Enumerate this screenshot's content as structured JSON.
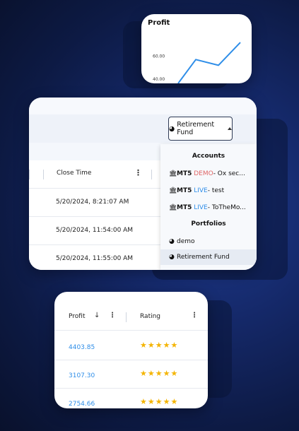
{
  "profit_chart": {
    "title": "Profit",
    "y_tick_labels": [
      "60.00",
      "40.00"
    ],
    "line_color": "#2f8ee8",
    "chart_data": {
      "type": "line",
      "title": "Profit",
      "yticks": [
        60,
        40
      ],
      "ylim": [
        38,
        82
      ],
      "series": [
        {
          "values": [
            36,
            57,
            52,
            72
          ]
        }
      ]
    }
  },
  "portfolio_selector": {
    "selected_label": "Retirement Fund",
    "icon": "pie-chart-icon"
  },
  "trades_table": {
    "close_time_header": "Close Time",
    "rows": [
      {
        "close_time": "5/20/2024, 8:21:07 AM"
      },
      {
        "close_time": "5/20/2024, 11:54:00 AM"
      },
      {
        "close_time": "5/20/2024, 11:55:00 AM"
      }
    ]
  },
  "dropdown_menu": {
    "accounts_heading": "Accounts",
    "accounts": [
      {
        "platform": "MT5",
        "type": "DEMO",
        "name": " - Ox sec...",
        "icon": "bank-icon"
      },
      {
        "platform": "MT5",
        "type": "LIVE",
        "name": " - test",
        "icon": "bank-icon"
      },
      {
        "platform": "MT5",
        "type": "LIVE",
        "name": " - ToTheMo...",
        "icon": "bank-icon"
      }
    ],
    "portfolios_heading": "Portfolios",
    "portfolios": [
      {
        "name": "demo",
        "selected": false,
        "icon": "pie-chart-icon"
      },
      {
        "name": "Retirement Fund",
        "selected": true,
        "icon": "pie-chart-icon"
      }
    ]
  },
  "ranking_table": {
    "profit_header": "Profit",
    "rating_header": "Rating",
    "rows": [
      {
        "profit": "4403.85",
        "rating": "★★★★★"
      },
      {
        "profit": "3107.30",
        "rating": "★★★★★"
      },
      {
        "profit": "2754.66",
        "rating": "★★★★★"
      }
    ]
  },
  "colors": {
    "accent_blue": "#2f8ee8",
    "demo_red": "#e06666",
    "star_gold": "#f4b400"
  }
}
